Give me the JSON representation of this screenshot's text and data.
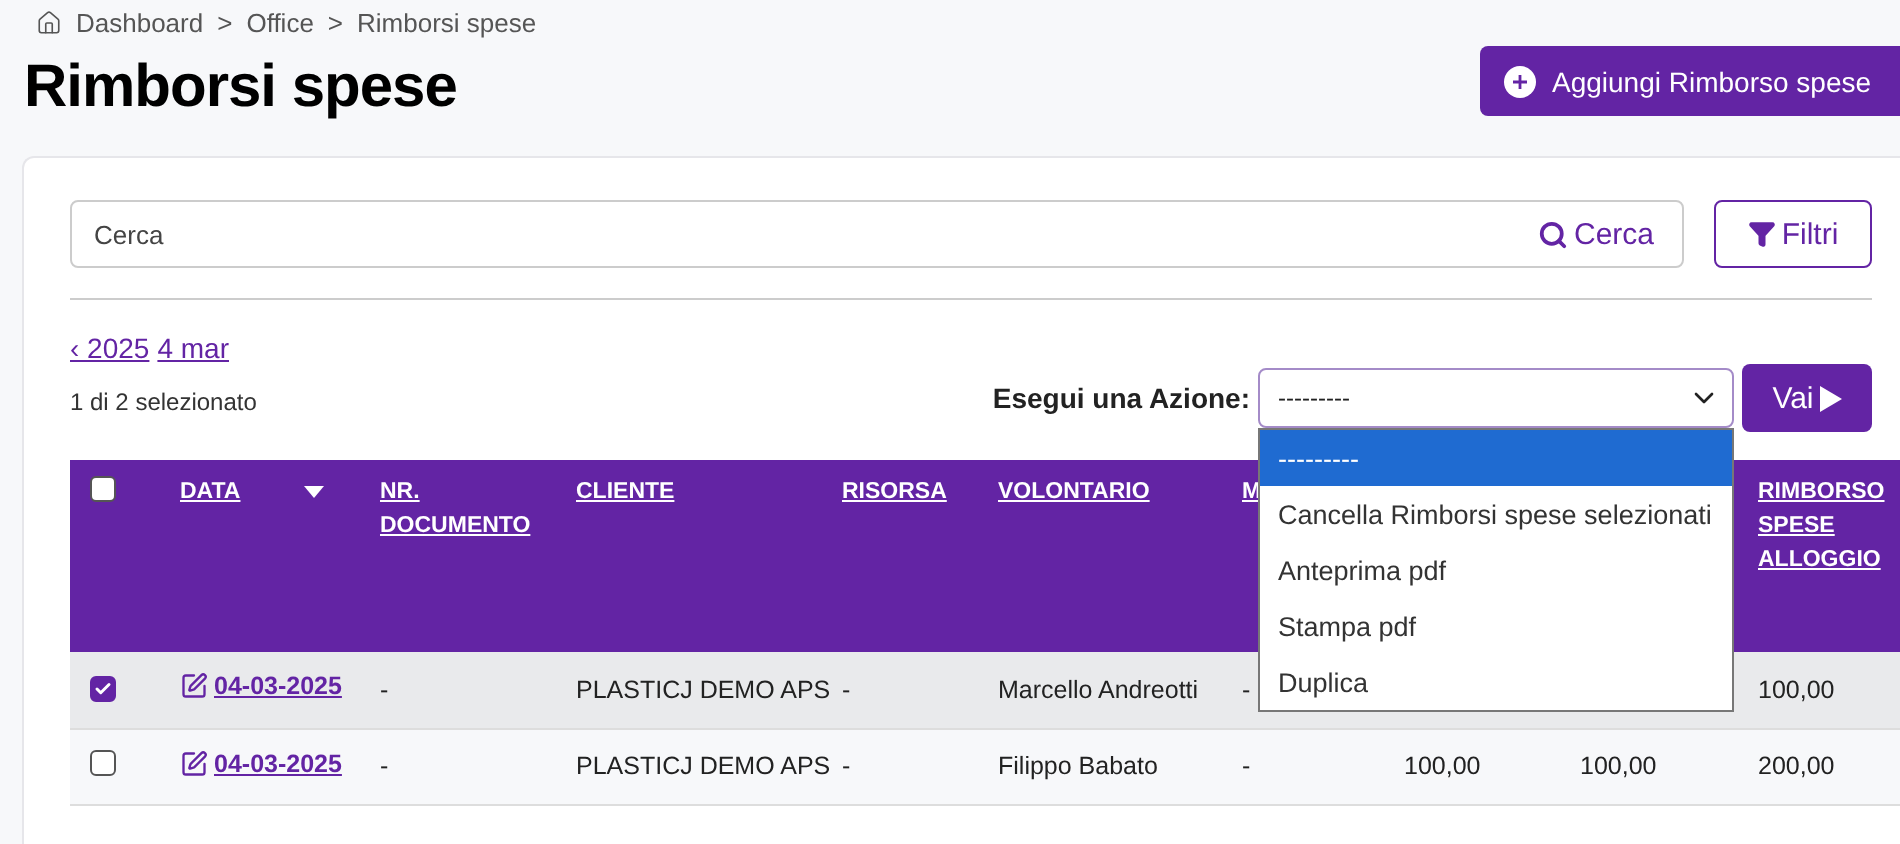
{
  "breadcrumb": {
    "separator": ">",
    "items": [
      {
        "label": "Dashboard"
      },
      {
        "label": "Office"
      },
      {
        "label": "Rimborsi spese"
      }
    ]
  },
  "title": "Rimborsi spese",
  "add_button": "Aggiungi Rimborso spese",
  "search": {
    "placeholder": "Cerca",
    "button": "Cerca"
  },
  "filter_button": "Filtri",
  "date_nav": [
    {
      "label": "‹ 2025"
    },
    {
      "label": "4 mar"
    }
  ],
  "selection_count": "1 di 2 selezionato",
  "action": {
    "label": "Esegui una Azione:",
    "value": "---------",
    "expanded": true,
    "options": [
      {
        "label": "---------",
        "selected": true
      },
      {
        "label": "Cancella Rimborsi spese selezionati",
        "selected": false
      },
      {
        "label": "Anteprima pdf",
        "selected": false
      },
      {
        "label": "Stampa pdf",
        "selected": false
      },
      {
        "label": "Duplica",
        "selected": false
      }
    ]
  },
  "go_button": "Vai",
  "table": {
    "select_all": {
      "checked": false
    },
    "columns": [
      {
        "label": "DATA",
        "sorted": true
      },
      {
        "label": "NR. DOCUMENTO",
        "sorted": false
      },
      {
        "label": "CLIENTE",
        "sorted": false
      },
      {
        "label": "RISORSA",
        "sorted": false
      },
      {
        "label": "VOLONTARIO",
        "sorted": false
      },
      {
        "label": "M",
        "sorted": false
      },
      null,
      null,
      {
        "label": "RIMBORSO SPESE ALLOGGIO",
        "sorted": false
      }
    ],
    "rows": [
      {
        "selected": true,
        "cells": [
          "04-03-2025",
          "-",
          "PLASTICJ DEMO APS",
          "-",
          "Marcello Andreotti",
          "-",
          null,
          null,
          "100,00"
        ]
      },
      {
        "selected": false,
        "cells": [
          "04-03-2025",
          "-",
          "PLASTICJ DEMO APS",
          "-",
          "Filippo Babato",
          "-",
          "100,00",
          "100,00",
          "200,00"
        ]
      }
    ]
  }
}
